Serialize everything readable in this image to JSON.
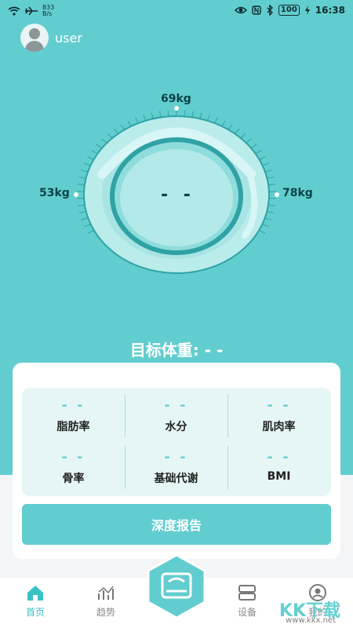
{
  "status": {
    "net_speed_top": "833",
    "net_speed_bottom": "B/s",
    "battery": "100",
    "time": "16:38"
  },
  "user": {
    "name": "user"
  },
  "gauge": {
    "top_label": "69kg",
    "left_label": "53kg",
    "right_label": "78kg",
    "center_value": "- -"
  },
  "target_weight": "目标体重: - -",
  "metrics": [
    {
      "value": "- -",
      "name": "脂肪率"
    },
    {
      "value": "- -",
      "name": "水分"
    },
    {
      "value": "- -",
      "name": "肌肉率"
    },
    {
      "value": "- -",
      "name": "骨率"
    },
    {
      "value": "- -",
      "name": "基础代谢"
    },
    {
      "value": "- -",
      "name": "BMI"
    }
  ],
  "report_button": "深度报告",
  "nav": {
    "home": "首页",
    "trend": "趋势",
    "device": "设备",
    "mine": "我的"
  },
  "watermark": {
    "main": "KK下载",
    "sub": "www.kkx.net"
  }
}
